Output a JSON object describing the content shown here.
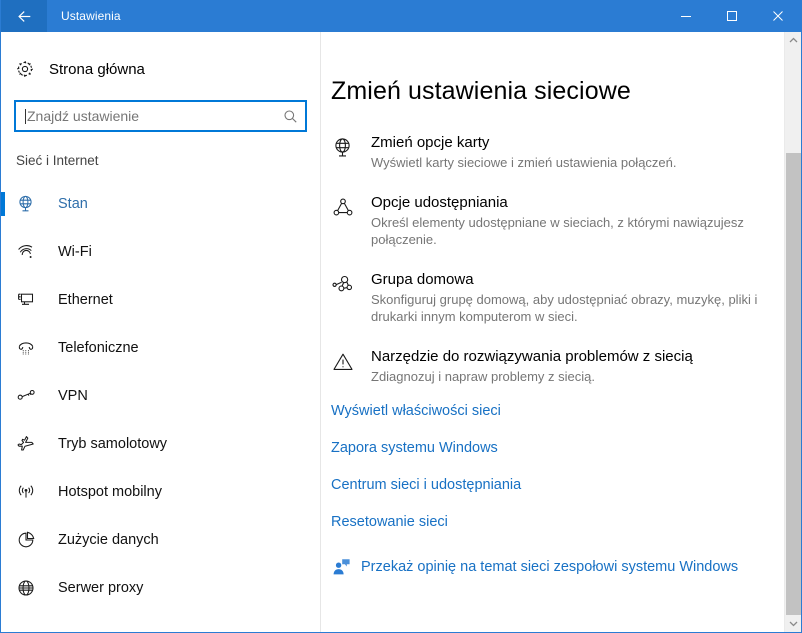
{
  "window": {
    "title": "Ustawienia",
    "back_icon": "back-arrow-icon",
    "minimize_label": "—",
    "maximize_label": "□",
    "close_label": "✕",
    "accent_color": "#2b7cd3",
    "link_color": "#1871c4",
    "selection_color": "#0078d7"
  },
  "sidebar": {
    "home": {
      "label": "Strona główna",
      "icon": "gear-icon"
    },
    "search": {
      "value": "",
      "placeholder": "Znajdź ustawienie",
      "icon": "search-icon"
    },
    "category": "Sieć i Internet",
    "items": [
      {
        "label": "Stan",
        "icon": "globe-monitor-icon",
        "selected": true
      },
      {
        "label": "Wi-Fi",
        "icon": "wifi-icon",
        "selected": false
      },
      {
        "label": "Ethernet",
        "icon": "ethernet-icon",
        "selected": false
      },
      {
        "label": "Telefoniczne",
        "icon": "dialup-phone-icon",
        "selected": false
      },
      {
        "label": "VPN",
        "icon": "vpn-key-icon",
        "selected": false
      },
      {
        "label": "Tryb samolotowy",
        "icon": "airplane-icon",
        "selected": false
      },
      {
        "label": "Hotspot mobilny",
        "icon": "broadcast-icon",
        "selected": false
      },
      {
        "label": "Zużycie danych",
        "icon": "pie-chart-icon",
        "selected": false
      },
      {
        "label": "Serwer proxy",
        "icon": "globe-icon",
        "selected": false
      }
    ]
  },
  "main": {
    "heading": "Zmień ustawienia sieciowe",
    "settings": [
      {
        "icon": "network-adapter-icon",
        "title": "Zmień opcje karty",
        "desc": "Wyświetl karty sieciowe i zmień ustawienia połączeń."
      },
      {
        "icon": "sharing-icon",
        "title": "Opcje udostępniania",
        "desc": "Określ elementy udostępniane w sieciach, z którymi nawiązujesz połączenie."
      },
      {
        "icon": "homegroup-icon",
        "title": "Grupa domowa",
        "desc": "Skonfiguruj grupę domową, aby udostępniać obrazy, muzykę, pliki i drukarki innym komputerom w sieci."
      },
      {
        "icon": "warning-triangle-icon",
        "title": "Narzędzie do rozwiązywania problemów z siecią",
        "desc": "Zdiagnozuj i napraw problemy z siecią."
      }
    ],
    "links": [
      "Wyświetl właściwości sieci",
      "Zapora systemu Windows",
      "Centrum sieci i udostępniania",
      "Resetowanie sieci"
    ],
    "feedback": {
      "icon": "feedback-person-icon",
      "label": "Przekaż opinię na temat sieci zespołowi systemu Windows"
    }
  },
  "scrollbar": {
    "up_icon": "scroll-up-arrow-icon",
    "down_icon": "scroll-down-arrow-icon"
  }
}
